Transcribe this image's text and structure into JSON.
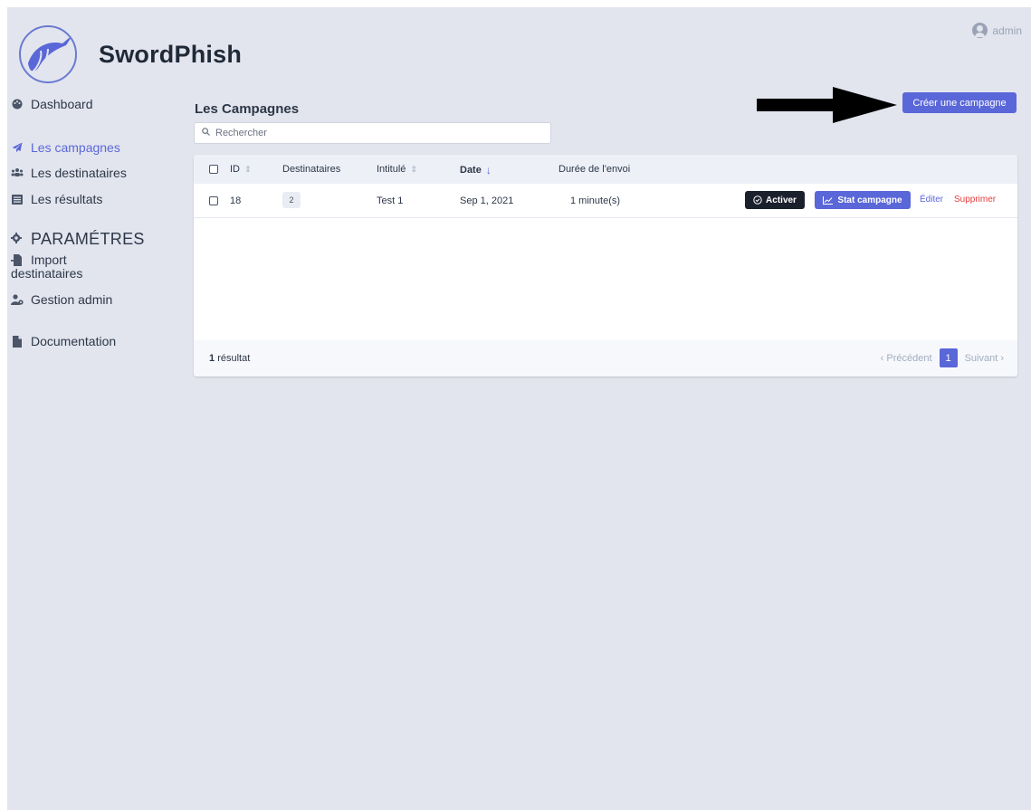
{
  "app": {
    "logo_text": "SwordPhish",
    "user_name": "admin",
    "colors": {
      "accent": "#5a67d8",
      "background": "#e2e5ee",
      "danger": "#e53e3e"
    }
  },
  "sidebar": {
    "items": [
      {
        "label": "Dashboard",
        "icon": "palette-icon"
      },
      {
        "label": "Les campagnes",
        "icon": "paper-plane-icon",
        "active": true
      },
      {
        "label": "Les destinataires",
        "icon": "users-icon"
      },
      {
        "label": "Les résultats",
        "icon": "list-icon"
      }
    ],
    "section_label": "PARAMÉTRES",
    "settings": [
      {
        "label_line1": "Import",
        "label_line2": "destinataires",
        "icon": "file-import-icon"
      },
      {
        "label": "Gestion admin",
        "icon": "user-cog-icon"
      },
      {
        "label": "Documentation",
        "icon": "file-icon"
      }
    ]
  },
  "main": {
    "title": "Les Campagnes",
    "search_placeholder": "Rechercher",
    "create_button": "Créer une campagne",
    "table": {
      "headers": {
        "id": "ID",
        "destinataires": "Destinataires",
        "intitule": "Intitulé",
        "date": "Date",
        "duree": "Durée de l'envoi"
      },
      "rows": [
        {
          "id": "18",
          "destinataires": "2",
          "intitule": "Test 1",
          "date": "Sep 1, 2021",
          "duree": "1 minute(s)",
          "activate_label": "Activer",
          "stat_label": "Stat campagne",
          "edit_label": "Éditer",
          "delete_label": "Supprimer"
        }
      ]
    },
    "footer": {
      "count_number": "1",
      "count_label": "résultat",
      "prev_label": "Précédent",
      "current_page": "1",
      "next_label": "Suivant"
    }
  }
}
